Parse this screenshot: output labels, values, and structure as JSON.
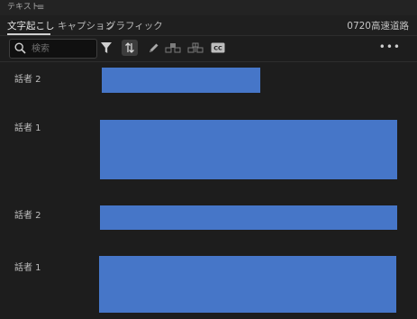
{
  "panel": {
    "title": "テキスト",
    "menu_icon": "hamburger-icon"
  },
  "tabs": [
    {
      "label": "文字起こし",
      "active": true
    },
    {
      "label": "キャプション",
      "active": false
    },
    {
      "label": "グラフィック",
      "active": false
    }
  ],
  "project_name": "0720高速道路",
  "toolbar": {
    "search_placeholder": "検索",
    "icons": [
      "search-icon",
      "filter-icon",
      "sync-icon",
      "pencil-icon",
      "merge-segments-icon",
      "split-segment-icon",
      "closed-captions-icon",
      "more-options-icon"
    ],
    "cc_label": "CC",
    "more_label": "•••"
  },
  "segments": [
    {
      "speaker": "話者 2"
    },
    {
      "speaker": "話者 1"
    },
    {
      "speaker": "話者 2"
    },
    {
      "speaker": "話者 1"
    }
  ],
  "colors": {
    "accent_block": "#4676c8",
    "background": "#1d1d1d"
  }
}
